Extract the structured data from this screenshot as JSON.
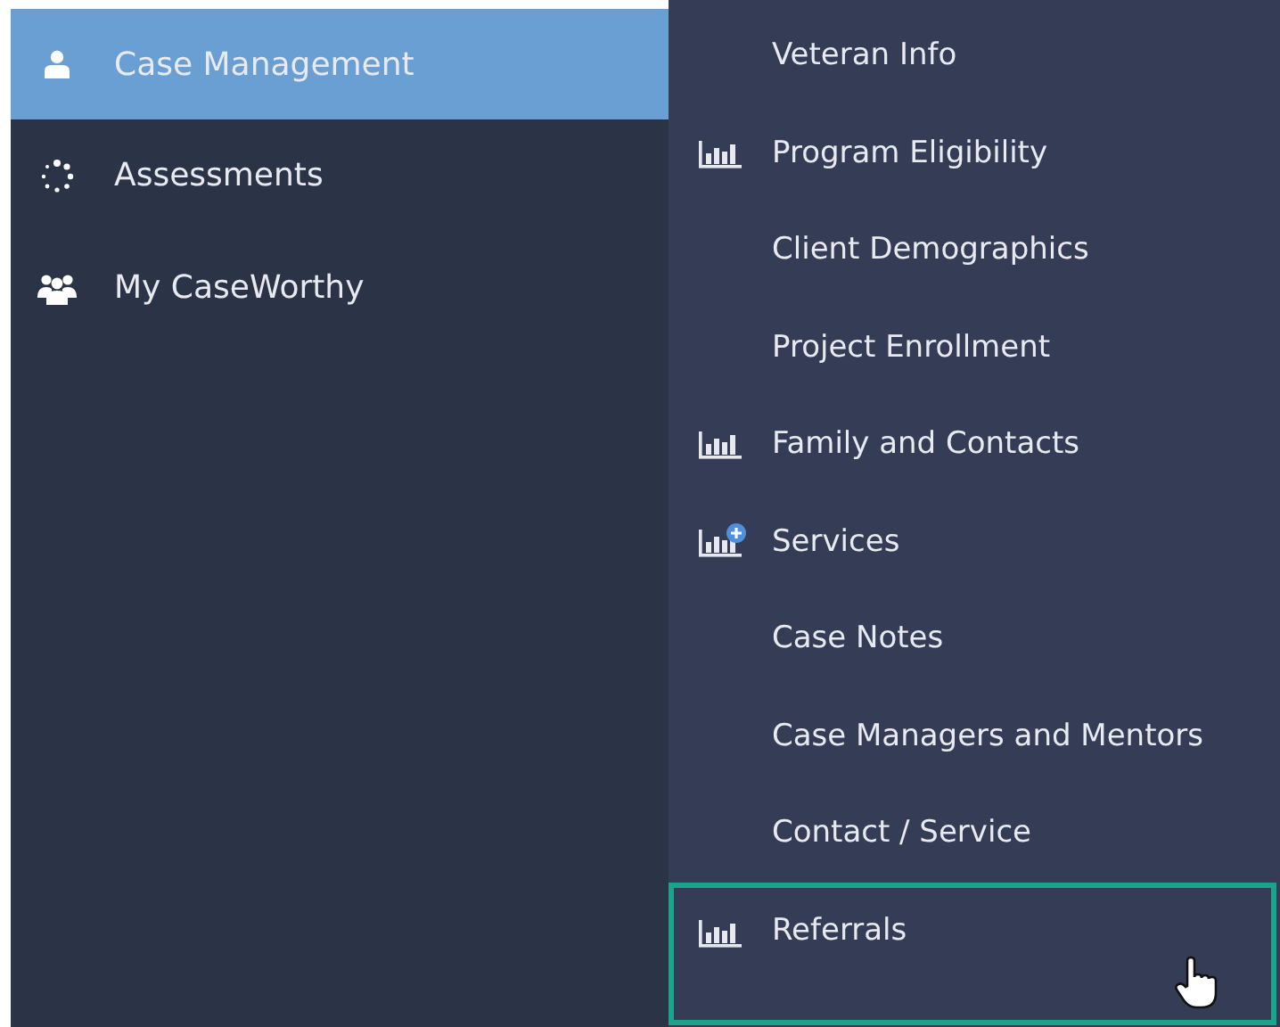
{
  "sidebar": {
    "items": [
      {
        "label": "Case Management",
        "selected": true
      },
      {
        "label": "Assessments",
        "selected": false
      },
      {
        "label": "My CaseWorthy",
        "selected": false
      }
    ]
  },
  "submenu": {
    "items": [
      {
        "label": "Veteran Info",
        "kind": "plain",
        "hovered": false
      },
      {
        "label": "Program Eligibility",
        "kind": "chart",
        "hovered": false
      },
      {
        "label": "Client Demographics",
        "kind": "plain",
        "hovered": false
      },
      {
        "label": "Project Enrollment",
        "kind": "plain",
        "hovered": false
      },
      {
        "label": "Family and Contacts",
        "kind": "chart",
        "hovered": false
      },
      {
        "label": "Services",
        "kind": "chartplus",
        "hovered": false
      },
      {
        "label": "Case Notes",
        "kind": "plain",
        "hovered": false
      },
      {
        "label": "Case Managers and Mentors",
        "kind": "plain",
        "hovered": false
      },
      {
        "label": "Contact / Service",
        "kind": "plain",
        "hovered": false
      },
      {
        "label": "Referrals",
        "kind": "chart",
        "hovered": true
      }
    ]
  }
}
